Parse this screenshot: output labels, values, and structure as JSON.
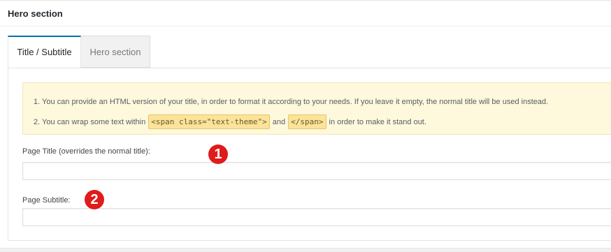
{
  "metabox": {
    "title": "Hero section"
  },
  "tabs": [
    {
      "label": "Title / Subtitle",
      "active": true
    },
    {
      "label": "Hero section",
      "active": false
    }
  ],
  "notice": {
    "line1": "1. You can provide an HTML version of your title, in order to format it according to your needs. If you leave it empty, the normal title will be used instead.",
    "line2_prefix": "2. You can wrap some text within",
    "code_open": "<span class=\"text-theme\">",
    "line2_and": "and",
    "code_close": "</span>",
    "line2_suffix": "in order to make it stand out."
  },
  "fields": {
    "page_title": {
      "label": "Page Title (overrides the normal title):",
      "value": "",
      "placeholder": ""
    },
    "page_subtitle": {
      "label": "Page Subtitle:",
      "value": "",
      "placeholder": ""
    }
  },
  "callouts": {
    "first": "1",
    "second": "2"
  },
  "colors": {
    "accent": "#0073aa",
    "callout": "#e01b1b",
    "notice_bg": "#fef8dc",
    "code_bg": "#fbe39b"
  }
}
